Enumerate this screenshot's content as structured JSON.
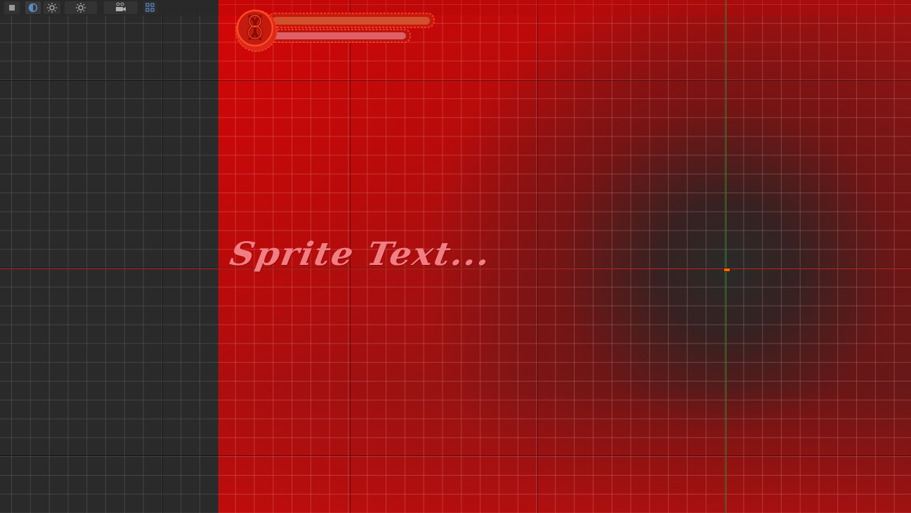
{
  "app": {
    "view": "scene-editor-2d"
  },
  "toolbar": {
    "buttons": [
      {
        "name": "stop-button",
        "icon": "stop-square-icon"
      },
      {
        "name": "mode-toggle-button",
        "icon": "half-circle-icon"
      },
      {
        "name": "light-button",
        "icon": "sun-icon"
      },
      {
        "name": "lighting-toggle-button",
        "icon": "sun-icon"
      },
      {
        "name": "camera-button",
        "icon": "camera-icon"
      },
      {
        "name": "grid-toggle-button",
        "icon": "grid-icon"
      }
    ]
  },
  "canvas": {
    "sprite_text": "Sprite Text...",
    "healthbar": {
      "emblem_icon": "celtic-knot-emblem-icon",
      "bar_fill": 1.0,
      "secondary_bar_fill": 1.0
    },
    "colors": {
      "background_dark": "#2a2a2a",
      "canvas_red": "#d40606",
      "text_pink": "#f07f84",
      "axis_x": "#c0221c",
      "axis_y": "#3aa02a",
      "origin_handle": "#ff6a00"
    }
  }
}
